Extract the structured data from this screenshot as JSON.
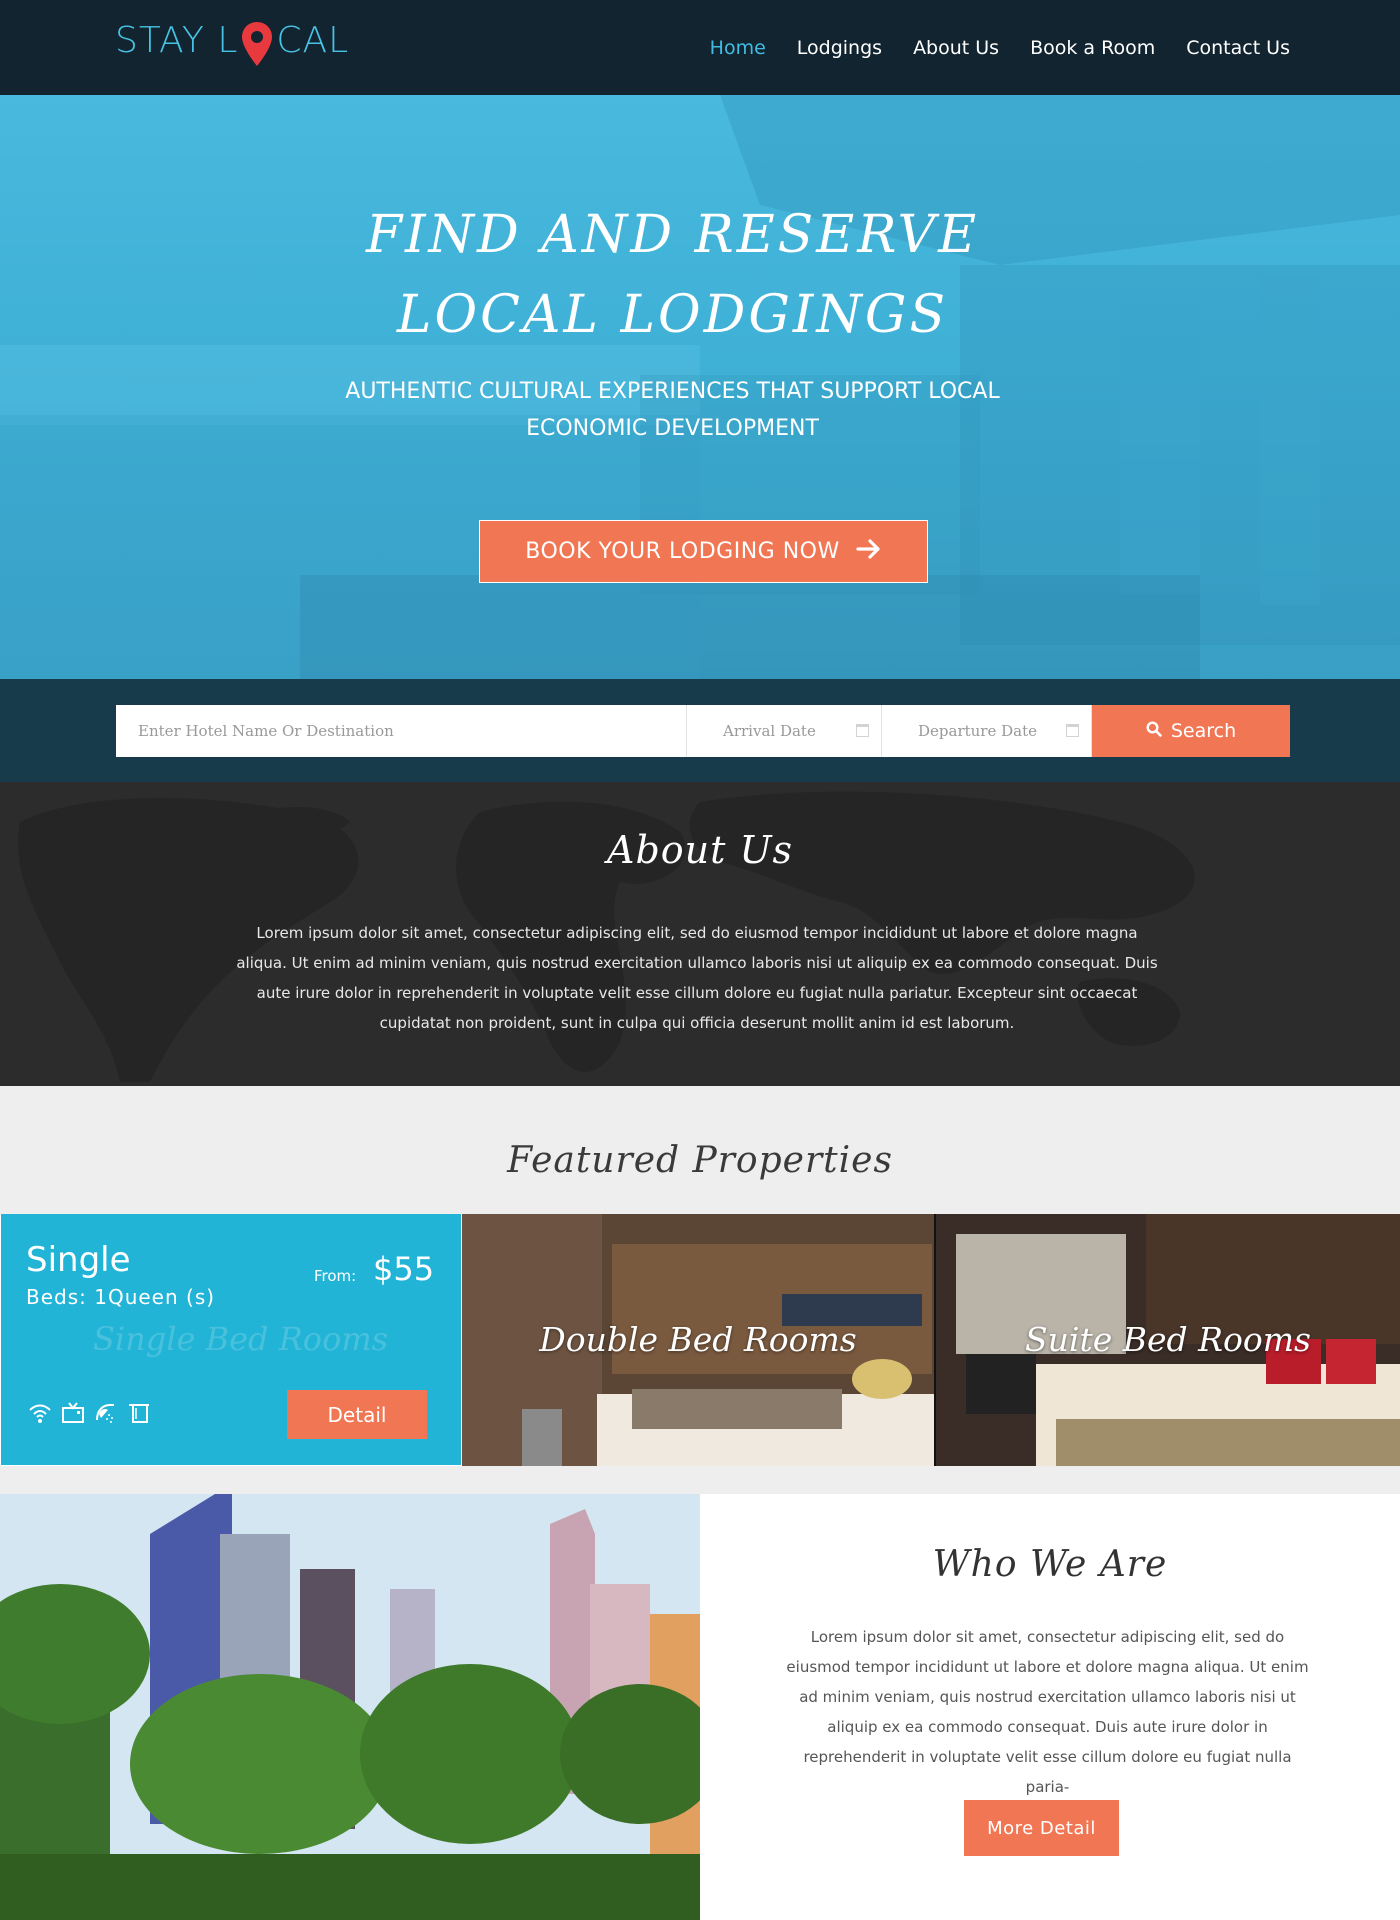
{
  "header": {
    "logo_left": "STAY L",
    "logo_right": "CAL",
    "nav": [
      "Home",
      "Lodgings",
      "About Us",
      "Book a Room",
      "Contact Us"
    ],
    "active_nav": "Home"
  },
  "hero": {
    "title_line1": "FIND AND RESERVE",
    "title_line2": "LOCAL LODGINGS",
    "subtitle_line1": "AUTHENTIC CULTURAL EXPERIENCES THAT SUPPORT LOCAL",
    "subtitle_line2": "ECONOMIC DEVELOPMENT",
    "cta_label": "BOOK YOUR LODGING NOW",
    "cta_icon": "arrow-right-icon"
  },
  "search": {
    "destination_placeholder": "Enter Hotel Name Or Destination",
    "arrival_placeholder": "Arrival Date",
    "departure_placeholder": "Departure Date",
    "button_label": "Search",
    "button_icon": "search-icon"
  },
  "about": {
    "title": "About Us",
    "text": "Lorem ipsum dolor sit amet, consectetur adipiscing elit, sed do eiusmod tempor incididunt ut labore et dolore magna aliqua. Ut enim ad minim veniam, quis nostrud exercitation ullamco laboris nisi ut aliquip ex ea commodo consequat. Duis aute irure dolor in reprehenderit in voluptate velit esse cillum dolore eu fugiat nulla pariatur. Excepteur sint occaecat cupidatat non proident, sunt in culpa qui officia deserunt mollit anim id est laborum."
  },
  "featured": {
    "title": "Featured Properties",
    "single": {
      "title": "Single",
      "beds": "Beds: 1Queen (s)",
      "from_label": "From:",
      "price": "$55",
      "ghost_label": "Single Bed Rooms",
      "amenities": [
        "wifi-icon",
        "tv-icon",
        "shower-icon",
        "towel-icon"
      ],
      "detail_label": "Detail"
    },
    "rooms": [
      {
        "label": "Double Bed Rooms"
      },
      {
        "label": "Suite Bed Rooms"
      }
    ]
  },
  "who": {
    "title": "Who We Are",
    "text": "Lorem ipsum dolor sit amet, consectetur adipiscing elit, sed do eiusmod tempor incididunt ut labore et dolore magna aliqua. Ut enim ad minim veniam, quis nostrud exercitation ullamco laboris nisi ut aliquip ex ea commodo consequat. Duis aute irure dolor in reprehenderit in voluptate velit esse cillum dolore eu fugiat nulla paria-",
    "button_label": "More Detail"
  },
  "colors": {
    "accent": "#f17754",
    "brand_blue": "#42bde2",
    "header_bg": "#11242f",
    "card_blue": "#21b4d6"
  }
}
